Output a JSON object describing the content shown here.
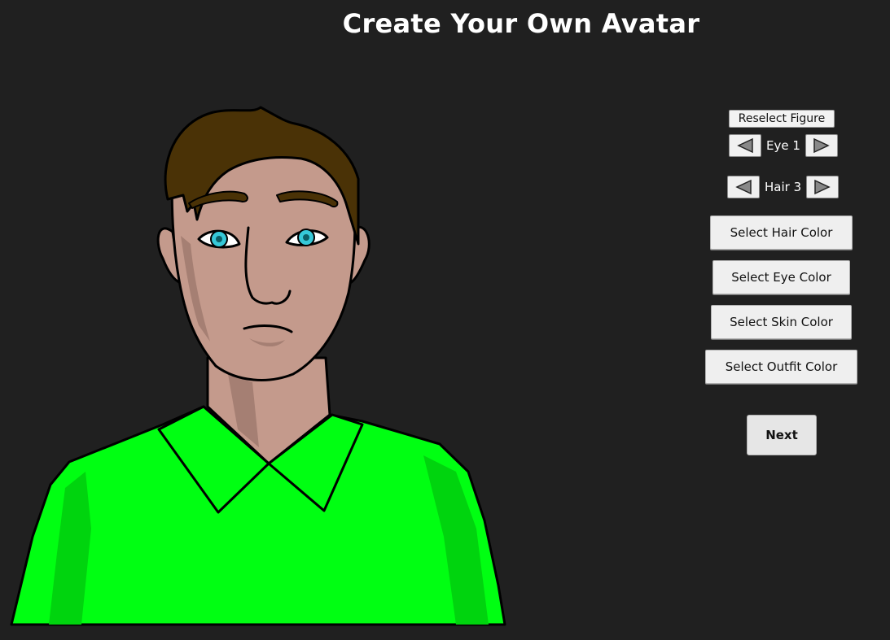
{
  "header": {
    "title": "Create Your Own Avatar"
  },
  "avatar": {
    "hair_color": "#4a3206",
    "eye_color": "#36c8d8",
    "skin_color": "#c49a8c",
    "skin_shadow_color": "#a57f73",
    "outfit_color": "#00ff12",
    "outfit_shadow_color": "#00d40e"
  },
  "controls": {
    "reselect_label": "Reselect Figure",
    "eye": {
      "label": "Eye 1"
    },
    "hair": {
      "label": "Hair 3"
    },
    "select_hair_color_label": "Select Hair Color",
    "select_eye_color_label": "Select Eye Color",
    "select_skin_color_label": "Select Skin Color",
    "select_outfit_color_label": "Select Outfit Color",
    "next_label": "Next"
  }
}
